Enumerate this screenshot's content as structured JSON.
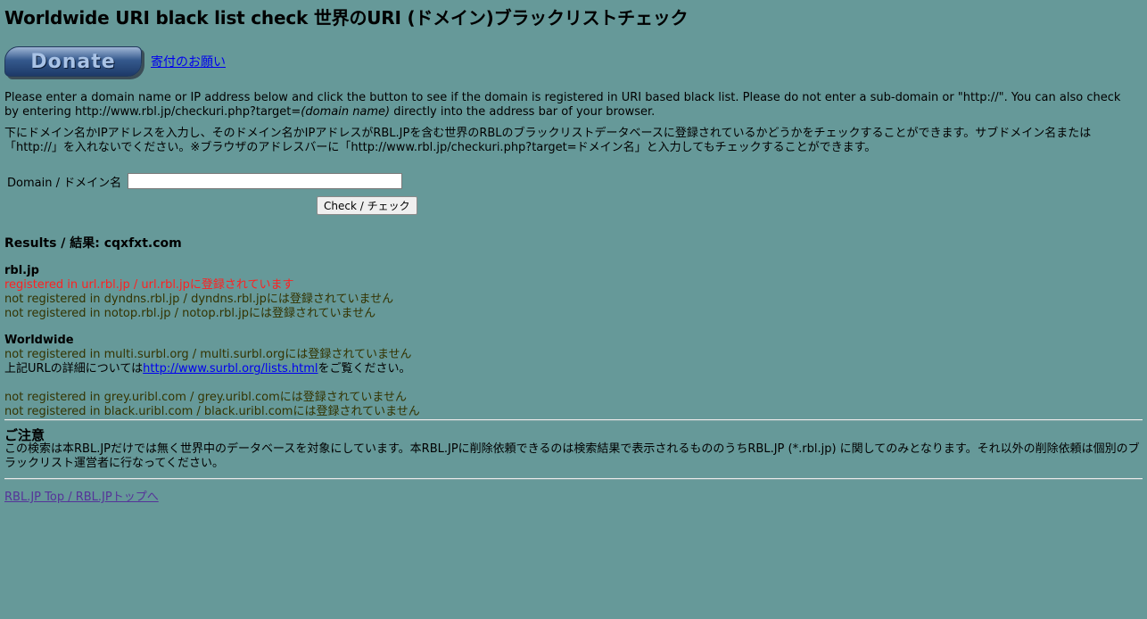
{
  "header": {
    "title": "Worldwide URI black list check 世界のURI (ドメイン)ブラックリストチェック"
  },
  "donate": {
    "button_label": "Donate",
    "link_label": "寄付のお願い"
  },
  "intro": {
    "en_before": "Please enter a domain name or IP address below and click the button to see if the domain is registered in URI based black list. Please do not enter a sub-domain or \"http://\". You can also check by entering http://www.rbl.jp/checkuri.php?target=",
    "en_em": "(domain name)",
    "en_after": " directly into the address bar of your browser.",
    "ja": "下にドメイン名かIPアドレスを入力し、そのドメイン名かIPアドレスがRBL.JPを含む世界のRBLのブラックリストデータベースに登録されているかどうかをチェックすることができます。サブドメイン名または「http://」を入れないでください。※ブラウザのアドレスバーに「http://www.rbl.jp/checkuri.php?target=ドメイン名」と入力してもチェックすることができます。"
  },
  "form": {
    "domain_label": "Domain / ドメイン名",
    "domain_value": "",
    "check_button": "Check / チェック"
  },
  "results": {
    "heading": "Results / 結果: cqxfxt.com",
    "rbl_jp": {
      "title": "rbl.jp",
      "lines": [
        "registered in url.rbl.jp / url.rbl.jpに登録されています",
        "not registered in dyndns.rbl.jp / dyndns.rbl.jpには登録されていません",
        "not registered in notop.rbl.jp / notop.rbl.jpには登録されていません"
      ]
    },
    "worldwide": {
      "title": "Worldwide",
      "surbl_line": "not registered in multi.surbl.org / multi.surbl.orgには登録されていません",
      "surbl_detail_before": "上記URLの詳細については",
      "surbl_detail_link": "http://www.surbl.org/lists.html",
      "surbl_detail_after": "をご覧ください。",
      "uribl_lines": [
        "not registered in grey.uribl.com / grey.uribl.comには登録されていません",
        "not registered in black.uribl.com / black.uribl.comには登録されていません"
      ]
    }
  },
  "notice": {
    "title": "ご注意",
    "text": "この検索は本RBL.JPだけでは無く世界中のデータベースを対象にしています。本RBL.JPに削除依頼できるのは検索結果で表示されるもののうちRBL.JP (*.rbl.jp) に関してのみとなります。それ以外の削除依頼は個別のブラックリスト運営者に行なってください。"
  },
  "footer": {
    "top_link": "RBL.JP Top / RBL.JPトップへ"
  },
  "colors": {
    "background": "#669999",
    "registered": "#ff2020",
    "not_registered": "#333300",
    "link": "#0000ee"
  }
}
